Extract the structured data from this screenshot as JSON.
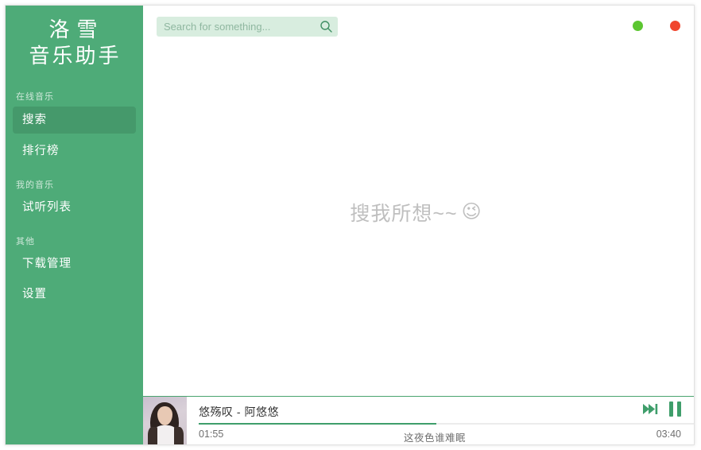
{
  "app": {
    "logo_line1": "洛雪",
    "logo_line2": "音乐助手"
  },
  "sidebar": {
    "sections": [
      {
        "header": "在线音乐",
        "items": [
          {
            "label": "搜索",
            "active": true
          },
          {
            "label": "排行榜",
            "active": false
          }
        ]
      },
      {
        "header": "我的音乐",
        "items": [
          {
            "label": "试听列表",
            "active": false
          }
        ]
      },
      {
        "header": "其他",
        "items": [
          {
            "label": "下载管理",
            "active": false
          },
          {
            "label": "设置",
            "active": false
          }
        ]
      }
    ]
  },
  "search": {
    "placeholder": "Search for something...",
    "value": "",
    "icon": "search-icon"
  },
  "window_controls": {
    "minimize_icon": "minimize-dot-icon",
    "minimize_color": "#5cc631",
    "close_icon": "close-dot-icon",
    "close_color": "#f0452d"
  },
  "content": {
    "empty_hint": "搜我所想~~",
    "empty_hint_emoji": "😉"
  },
  "player": {
    "album_art_alt": "album-art",
    "song_title": "悠殇叹 - 阿悠悠",
    "time_current": "01:55",
    "time_total": "03:40",
    "lyric_line": "这夜色谁难眠",
    "progress_percent": 48,
    "accent_color": "#3f9e6b",
    "next_icon": "next-track-icon",
    "pause_icon": "pause-icon"
  }
}
